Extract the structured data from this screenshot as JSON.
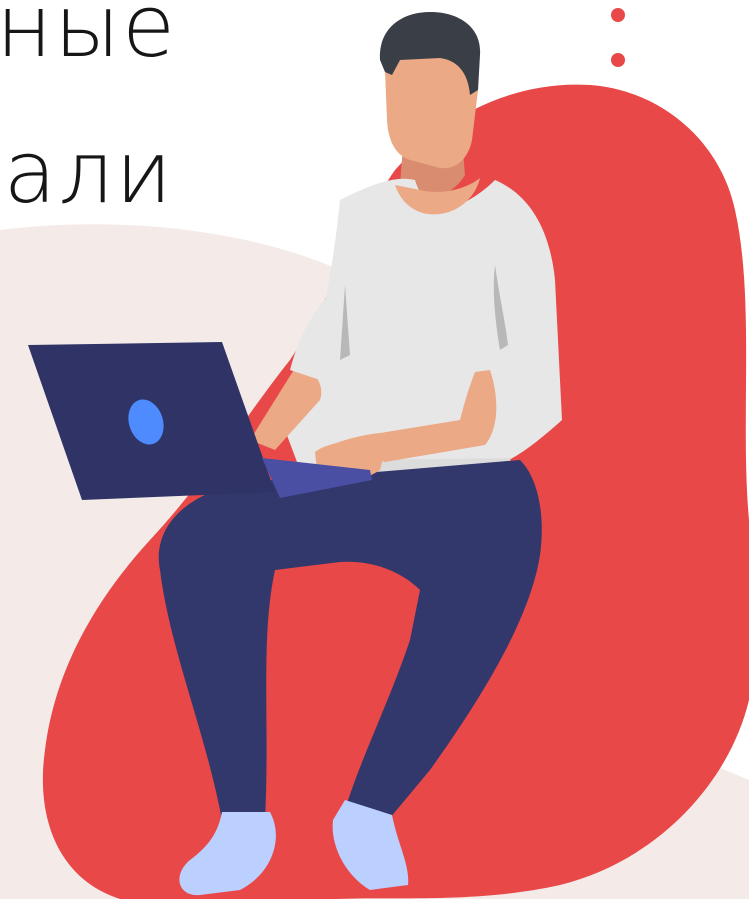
{
  "headline": {
    "line1": "ные",
    "line2": "али"
  },
  "colors": {
    "background": "#ffffff",
    "blob_light": "#f4ebe8",
    "blob_red": "#e84848",
    "hair": "#3a3f47",
    "skin": "#eba986",
    "shirt": "#e7e7e7",
    "trousers": "#33386c",
    "laptop": "#2f3366",
    "laptop_accent": "#4e8bff",
    "socks": "#bcd0ff",
    "dots": "#e84848"
  },
  "icons": [
    "menu-dots-icon",
    "person-with-laptop-illustration"
  ]
}
